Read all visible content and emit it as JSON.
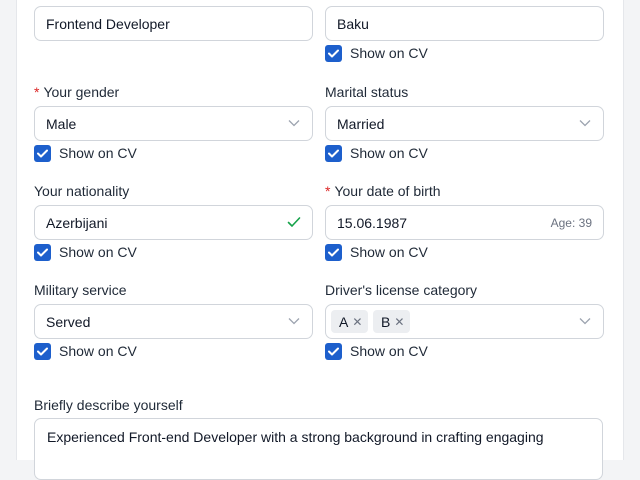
{
  "show_on_cv_label": "Show on CV",
  "fields": {
    "position": {
      "value": "Frontend Developer"
    },
    "city": {
      "value": "Baku"
    },
    "gender": {
      "label": "Your gender",
      "required": "*",
      "value": "Male"
    },
    "marital": {
      "label": "Marital status",
      "value": "Married"
    },
    "nationality": {
      "label": "Your nationality",
      "value": "Azerbijani"
    },
    "birth": {
      "label": "Your date of birth",
      "required": "*",
      "value": "15.06.1987",
      "age": "Age: 39"
    },
    "military": {
      "label": "Military service",
      "value": "Served"
    },
    "license": {
      "label": "Driver's license category",
      "tags": [
        "A",
        "B"
      ]
    },
    "about": {
      "label": "Briefly describe yourself",
      "value": "Experienced Front-end Developer with a strong background in crafting engaging"
    }
  },
  "colors": {
    "accent": "#1d5fcc",
    "required": "#dc2626",
    "valid": "#16a34a",
    "border": "#d1d5db"
  }
}
